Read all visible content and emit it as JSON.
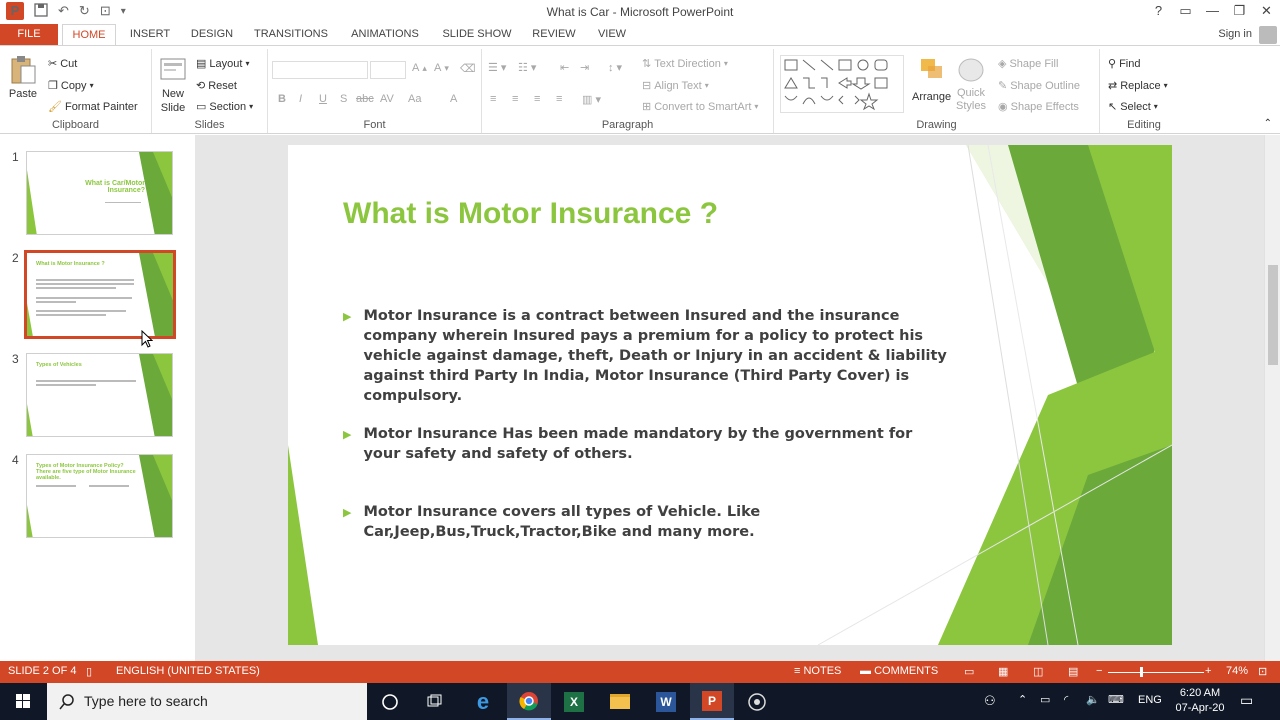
{
  "window": {
    "title": "What is Car - Microsoft PowerPoint",
    "app_letter": "P",
    "controls": [
      "?",
      "▭",
      "—",
      "❐",
      "✕"
    ]
  },
  "tabs": {
    "file": "FILE",
    "items": [
      "HOME",
      "INSERT",
      "DESIGN",
      "TRANSITIONS",
      "ANIMATIONS",
      "SLIDE SHOW",
      "REVIEW",
      "VIEW"
    ],
    "active": "HOME",
    "sign_in": "Sign in"
  },
  "ribbon": {
    "clipboard": {
      "label": "Clipboard",
      "paste": "Paste",
      "cut": "Cut",
      "copy": "Copy",
      "format_painter": "Format Painter"
    },
    "slides": {
      "label": "Slides",
      "new_slide_1": "New",
      "new_slide_2": "Slide",
      "layout": "Layout",
      "reset": "Reset",
      "section": "Section"
    },
    "font": {
      "label": "Font",
      "bold": "B",
      "italic": "I",
      "underline": "U",
      "shadow": "S",
      "strike": "abc",
      "spacing": "AV",
      "case": "Aa",
      "color": "A"
    },
    "paragraph": {
      "label": "Paragraph",
      "text_direction": "Text Direction",
      "align_text": "Align Text",
      "smartart": "Convert to SmartArt"
    },
    "drawing": {
      "label": "Drawing",
      "arrange": "Arrange",
      "quick_styles_1": "Quick",
      "quick_styles_2": "Styles",
      "shape_fill": "Shape Fill",
      "shape_outline": "Shape Outline",
      "shape_effects": "Shape Effects"
    },
    "editing": {
      "label": "Editing",
      "find": "Find",
      "replace": "Replace",
      "select": "Select"
    }
  },
  "thumbnails": [
    {
      "num": "1",
      "title": "What is Car/Motor Insurance?"
    },
    {
      "num": "2",
      "title": "What is Motor Insurance ?"
    },
    {
      "num": "3",
      "title": "Types of Vehicles"
    },
    {
      "num": "4",
      "title": "Types of Motor Insurance Policy? There are five type of Motor Insurance available."
    }
  ],
  "slide": {
    "title": "What is Motor Insurance ?",
    "bullets": [
      "Motor Insurance is a contract between Insured and the insurance company wherein Insured pays a premium for a policy to protect his vehicle against damage, theft, Death or Injury in an accident & liability against third Party In India, Motor Insurance (Third Party Cover) is compulsory.",
      "Motor Insurance Has been made mandatory by the government for your safety and safety of others.",
      "Motor Insurance covers all types of Vehicle. Like Car,Jeep,Bus,Truck,Tractor,Bike and many more."
    ],
    "accent_color": "#8cc63f"
  },
  "status": {
    "slide_info": "SLIDE 2 OF 4",
    "language": "ENGLISH (UNITED STATES)",
    "notes": "NOTES",
    "comments": "COMMENTS",
    "zoom": "74%"
  },
  "taskbar": {
    "search_placeholder": "Type here to search",
    "time": "6:20 AM",
    "date": "07-Apr-20",
    "lang": "ENG"
  },
  "colors": {
    "brand": "#d24726",
    "green": "#8cc63f"
  }
}
